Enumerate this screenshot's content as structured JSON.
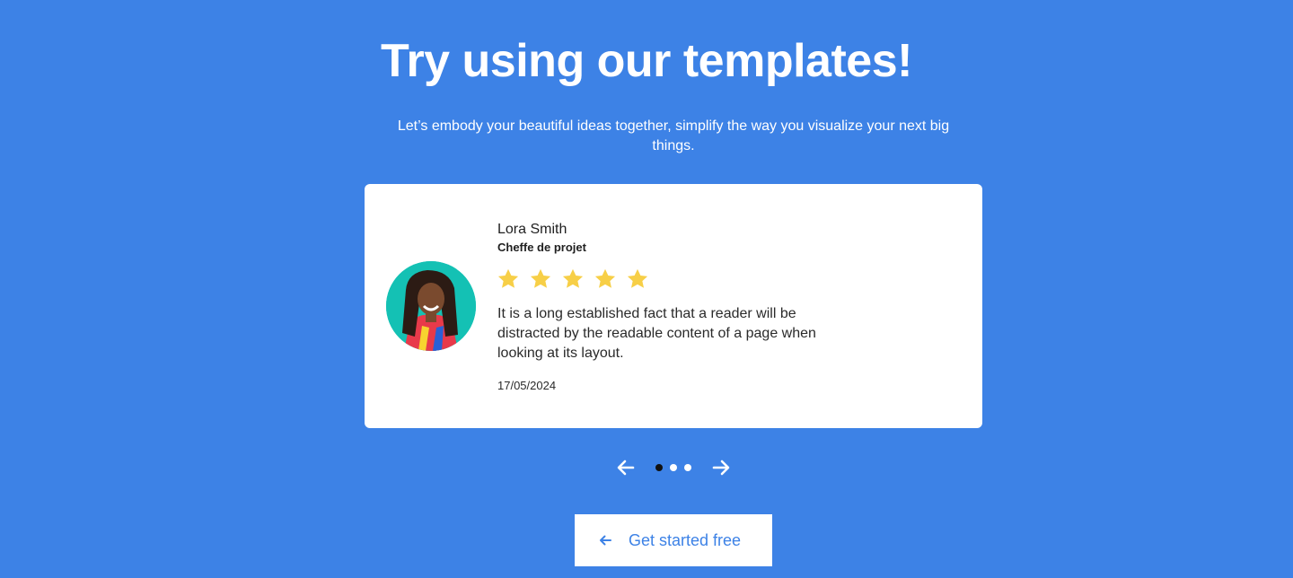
{
  "hero": {
    "title": "Try using our templates!",
    "subtitle": "Let’s embody your beautiful ideas together, simplify the way you visualize your next big things."
  },
  "testimonial": {
    "name": "Lora Smith",
    "role": "Cheffe de projet",
    "rating": 5,
    "rating_max": 5,
    "text": "It is a long established fact that a reader will be distracted by the readable content of a page when looking at its layout.",
    "date": "17/05/2024"
  },
  "carousel": {
    "slide_count": 3,
    "active_slide": 1,
    "prev_icon": "arrow-left-icon",
    "next_icon": "arrow-right-icon"
  },
  "cta": {
    "label": "Get started free",
    "icon": "arrow-left-icon"
  },
  "colors": {
    "background": "#3d82e6",
    "card": "#ffffff",
    "star": "#f7cf47",
    "active_dot": "#111111",
    "cta_text": "#3d82e6"
  }
}
